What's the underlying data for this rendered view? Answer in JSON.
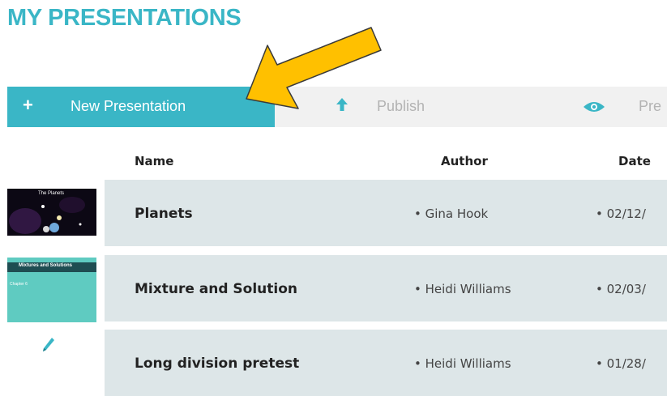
{
  "page": {
    "title": "MY PRESENTATIONS"
  },
  "toolbar": {
    "new_plus": "+",
    "new_label": "New Presentation",
    "publish_label": "Publish",
    "preview_label": "Pre"
  },
  "table": {
    "columns": [
      "Name",
      "Author",
      "Date"
    ],
    "rows": [
      {
        "name": "Planets",
        "author": "• Gina Hook",
        "date": "• 02/12/",
        "thumb_title": "The Planets"
      },
      {
        "name": "Mixture and Solution",
        "author": "• Heidi Williams",
        "date": "• 02/03/",
        "thumb_title": "Mixtures and Solutions",
        "thumb_sub": "Chapter 6"
      },
      {
        "name": "Long division pretest",
        "author": "• Heidi Williams",
        "date": "• 01/28/"
      }
    ]
  },
  "colors": {
    "accent": "#3ab6c6",
    "row_bg": "#dde6e8",
    "toolbar_bg": "#f1f1f1",
    "callout_arrow": "#ffc000"
  },
  "icons": {
    "new": "plus-icon",
    "publish": "upload-arrow-icon",
    "preview": "eye-icon",
    "edit": "pencil-icon",
    "callout": "yellow-callout-arrow"
  }
}
